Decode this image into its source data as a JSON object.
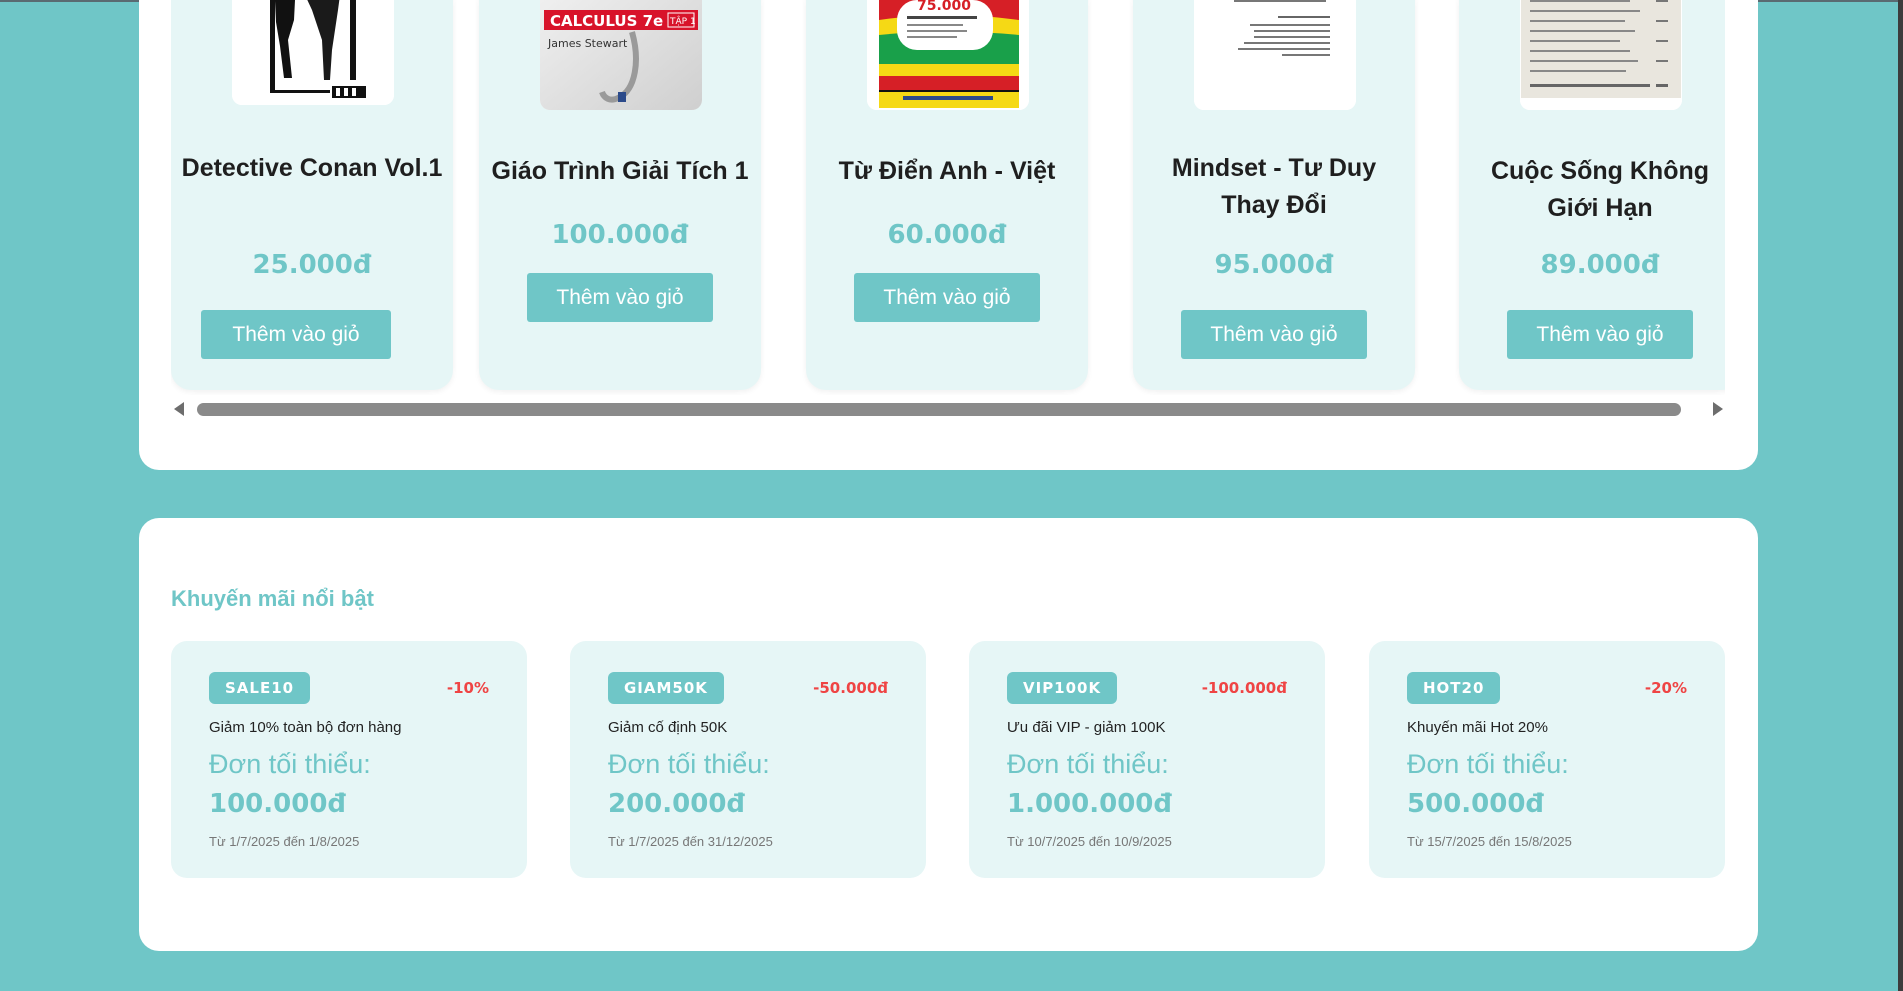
{
  "products": {
    "items": [
      {
        "name": "Detective Conan Vol.1",
        "price": "25.000đ",
        "button": "Thêm vào giỏ"
      },
      {
        "name": "Giáo Trình Giải Tích 1",
        "price": "100.000đ",
        "button": "Thêm vào giỏ",
        "cover_text": "CALCULUS 7e",
        "cover_tag": "TẬP 1",
        "cover_author": "James Stewart"
      },
      {
        "name": "Từ Điển Anh - Việt",
        "price": "60.000đ",
        "button": "Thêm vào giỏ",
        "cover_text": "75.000"
      },
      {
        "name": "Mindset - Tư Duy Thay Đổi",
        "price": "95.000đ",
        "button": "Thêm vào giỏ"
      },
      {
        "name": "Cuộc Sống Không Giới Hạn",
        "price": "89.000đ",
        "button": "Thêm vào giỏ"
      }
    ]
  },
  "promotions": {
    "title": "Khuyến mãi nổi bật",
    "items": [
      {
        "code": "SALE10",
        "discount": "-10%",
        "desc": "Giảm 10% toàn bộ đơn hàng",
        "min_label": "Đơn tối thiểu:",
        "min_value": "100.000đ",
        "dates": "Từ 1/7/2025 đến 1/8/2025"
      },
      {
        "code": "GIAM50K",
        "discount": "-50.000đ",
        "desc": "Giảm cố định 50K",
        "min_label": "Đơn tối thiểu:",
        "min_value": "200.000đ",
        "dates": "Từ 1/7/2025 đến 31/12/2025"
      },
      {
        "code": "VIP100K",
        "discount": "-100.000đ",
        "desc": "Ưu đãi VIP - giảm 100K",
        "min_label": "Đơn tối thiểu:",
        "min_value": "1.000.000đ",
        "dates": "Từ 10/7/2025 đến 10/9/2025"
      },
      {
        "code": "HOT20",
        "discount": "-20%",
        "desc": "Khuyến mãi Hot 20%",
        "min_label": "Đơn tối thiểu:",
        "min_value": "500.000đ",
        "dates": "Từ 15/7/2025 đến 15/8/2025"
      }
    ]
  },
  "colors": {
    "accent": "#6fc6c7",
    "card_bg": "#e6f6f6",
    "discount": "#ef4444"
  }
}
